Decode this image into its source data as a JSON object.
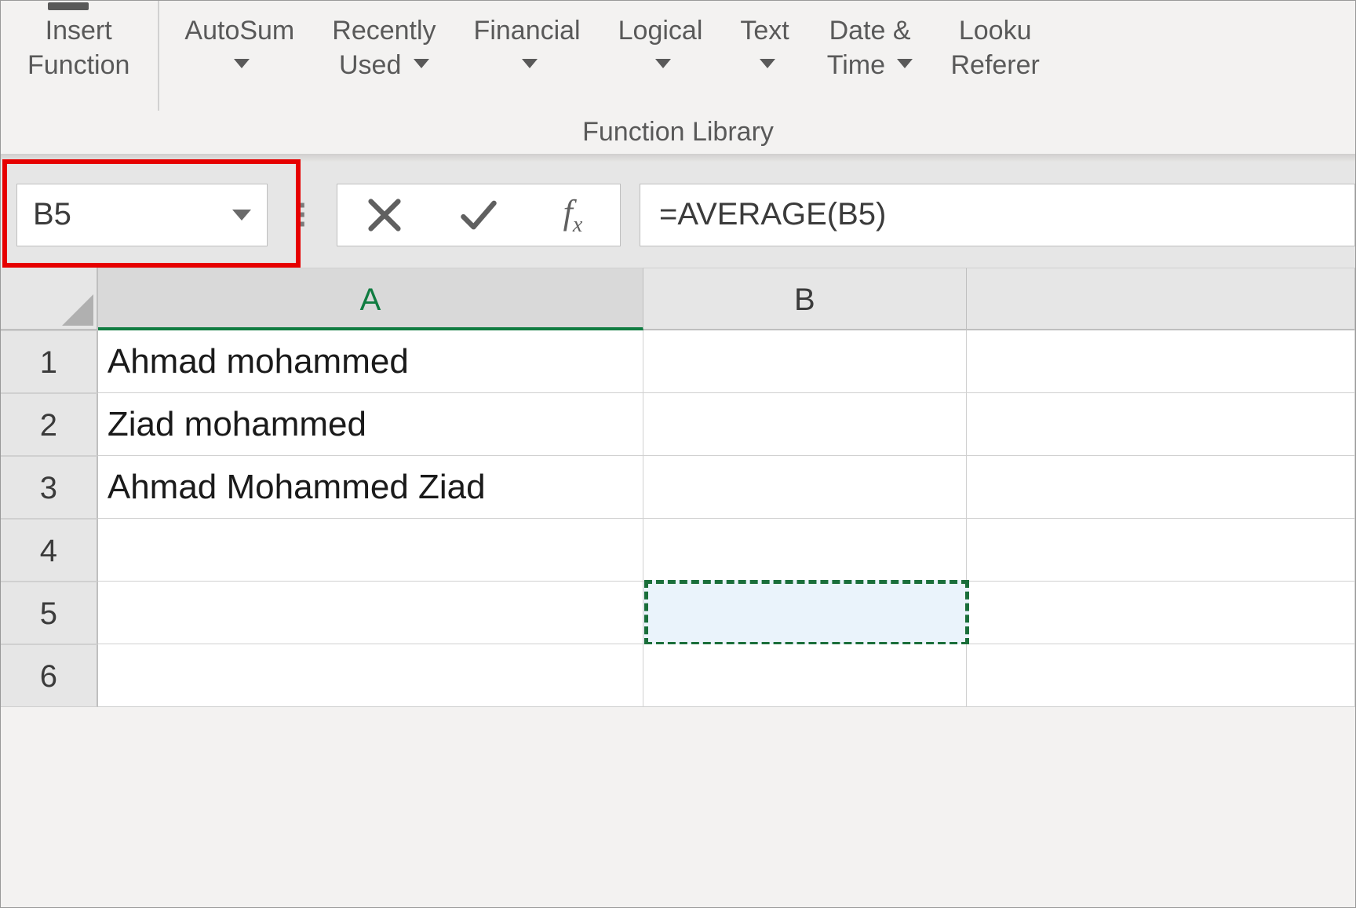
{
  "ribbon": {
    "buttons": [
      {
        "id": "insert-function",
        "line1": "Insert",
        "line2": "Function",
        "hasArrow": false
      },
      {
        "id": "autosum",
        "line1": "AutoSum",
        "line2_arrowOnly": true,
        "hasArrow": true
      },
      {
        "id": "recently-used",
        "line1": "Recently",
        "line2": "Used",
        "hasArrow": true
      },
      {
        "id": "financial",
        "line1": "Financial",
        "line2_arrowOnly": true,
        "hasArrow": true
      },
      {
        "id": "logical",
        "line1": "Logical",
        "line2_arrowOnly": true,
        "hasArrow": true
      },
      {
        "id": "text",
        "line1": "Text",
        "line2_arrowOnly": true,
        "hasArrow": true
      },
      {
        "id": "date-time",
        "line1": "Date &",
        "line2": "Time",
        "hasArrow": true
      },
      {
        "id": "lookup-reference",
        "line1": "Looku",
        "line2": "Referer",
        "hasArrow": false,
        "cut": true
      }
    ],
    "group_label": "Function Library"
  },
  "formula_bar": {
    "name_box": "B5",
    "formula": "=AVERAGE(B5)"
  },
  "grid": {
    "columns": [
      "A",
      "B"
    ],
    "active_column": "A",
    "rows": [
      "1",
      "2",
      "3",
      "4",
      "5",
      "6"
    ],
    "cells": {
      "A1": "Ahmad mohammed",
      "A2": "Ziad mohammed",
      "A3": "Ahmad Mohammed Ziad",
      "A4": "",
      "A5": "",
      "A6": "",
      "B1": "",
      "B2": "",
      "B3": "",
      "B4": "",
      "B5": "",
      "B6": ""
    },
    "selected": "B5"
  }
}
